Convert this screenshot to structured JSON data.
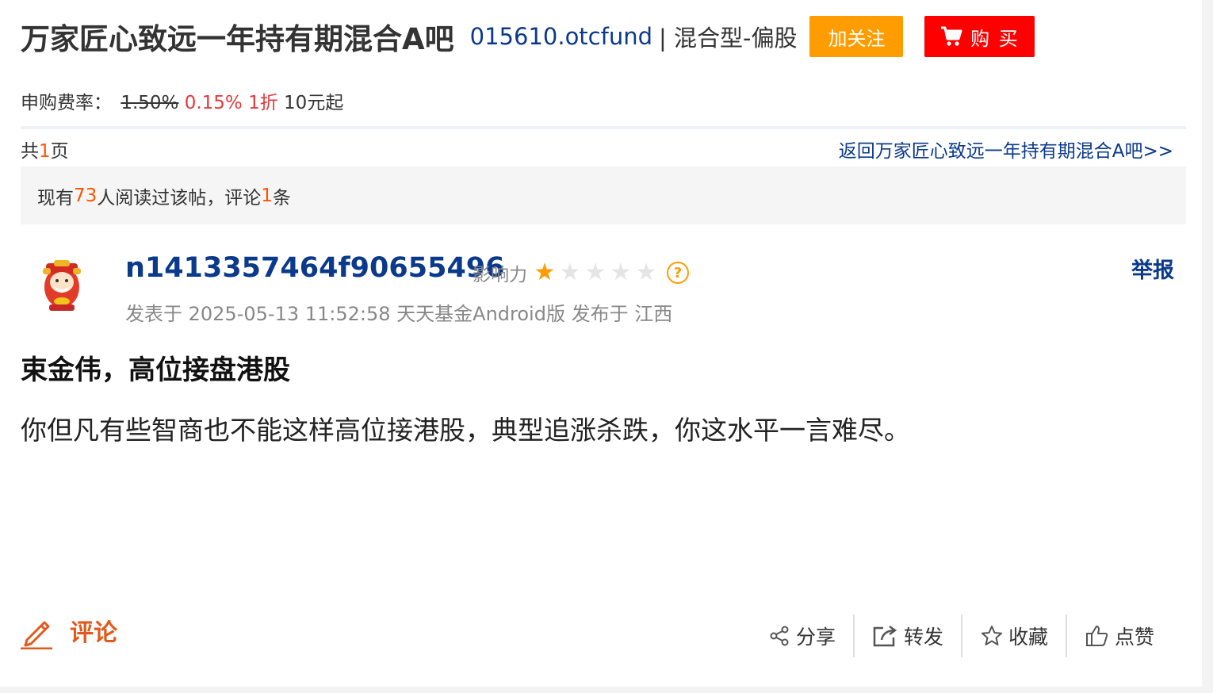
{
  "header": {
    "bar_title": "万家匠心致远一年持有期混合A吧",
    "fund_code": "015610.otcfund",
    "fund_type": "| 混合型-偏股",
    "follow_label": "加关注",
    "buy_label": "购 买"
  },
  "fee": {
    "label": "申购费率：",
    "original": "1.50%",
    "discounted": "0.15%",
    "discount": "1折",
    "minimum": "10元起"
  },
  "pager": {
    "prefix": "共",
    "count": "1",
    "suffix": "页",
    "back_link": "返回万家匠心致远一年持有期混合A吧>>"
  },
  "stats": {
    "prefix": "现有",
    "readers": "73",
    "middle": "人阅读过该帖，评论",
    "comments": "1",
    "suffix": "条"
  },
  "post": {
    "username": "n1413357464f90655496",
    "influence_label": "影响力",
    "influence_stars": 1,
    "influence_max": 5,
    "report_label": "举报",
    "meta": "发表于 2025-05-13 11:52:58 天天基金Android版 发布于 江西",
    "title": "束金伟，高位接盘港股",
    "body": "你但凡有些智商也不能这样高位接港股，典型追涨杀跌，你这水平一言难尽。"
  },
  "footer": {
    "comment_label": "评论",
    "share_label": "分享",
    "forward_label": "转发",
    "favorite_label": "收藏",
    "like_label": "点赞"
  },
  "colors": {
    "link_blue": "#0b3a8c",
    "follow_orange": "#ff9c00",
    "buy_red": "#ff0000",
    "highlight": "#ff5500",
    "comment_orange": "#e05a1d"
  },
  "icons": [
    "cart-icon",
    "help-icon",
    "pencil-icon",
    "share-icon",
    "forward-icon",
    "star-outline-icon",
    "thumb-up-icon"
  ]
}
